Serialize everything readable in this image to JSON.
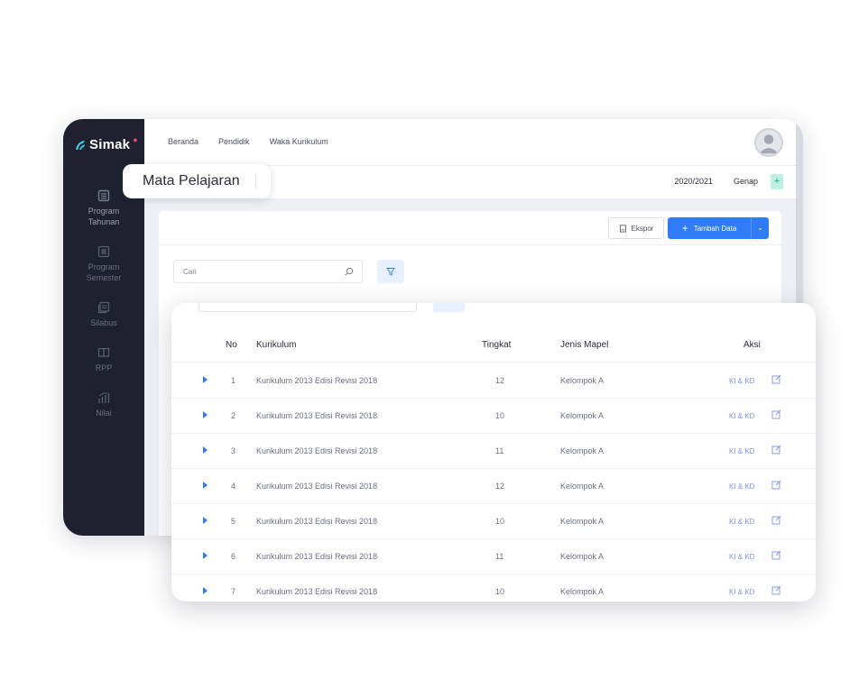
{
  "brand": {
    "name": "Simak"
  },
  "sidebar": {
    "items": [
      {
        "label": "Program Tahunan",
        "icon": "calendar-list-icon"
      },
      {
        "label": "Program Semester",
        "icon": "columns-icon"
      },
      {
        "label": "Silabus",
        "icon": "document-stack-icon"
      },
      {
        "label": "RPP",
        "icon": "book-open-icon"
      },
      {
        "label": "Nilai",
        "icon": "chart-up-icon"
      }
    ]
  },
  "topnav": {
    "items": [
      "Beranda",
      "Pendidik",
      "Waka Kurikulum"
    ]
  },
  "page": {
    "title": "Mata Pelajaran",
    "year": "2020/2021",
    "semester": "Genap"
  },
  "toolbar": {
    "export_label": "Ekspor",
    "add_label": "Tambah Data"
  },
  "search": {
    "placeholder": "Cari"
  },
  "table": {
    "headers": {
      "no": "No",
      "kurikulum": "Kurikulum",
      "tingkat": "Tingkat",
      "jenis": "Jenis Mapel",
      "aksi": "Aksi"
    },
    "action_link": "KI & KD",
    "rows": [
      {
        "no": "1",
        "kurikulum": "Kurikulum 2013 Edisi Revisi 2018",
        "tingkat": "12",
        "jenis": "Kelompok A"
      },
      {
        "no": "2",
        "kurikulum": "Kurikulum 2013 Edisi Revisi 2018",
        "tingkat": "10",
        "jenis": "Kelompok A"
      },
      {
        "no": "3",
        "kurikulum": "Kurikulum 2013 Edisi Revisi 2018",
        "tingkat": "11",
        "jenis": "Kelompok A"
      },
      {
        "no": "4",
        "kurikulum": "Kurikulum 2013 Edisi Revisi 2018",
        "tingkat": "12",
        "jenis": "Kelompok A"
      },
      {
        "no": "5",
        "kurikulum": "Kurikulum 2013 Edisi Revisi 2018",
        "tingkat": "10",
        "jenis": "Kelompok A"
      },
      {
        "no": "6",
        "kurikulum": "Kurikulum 2013 Edisi Revisi 2018",
        "tingkat": "11",
        "jenis": "Kelompok A"
      },
      {
        "no": "7",
        "kurikulum": "Kurikulum 2013 Edisi Revisi 2018",
        "tingkat": "10",
        "jenis": "Kelompok A"
      }
    ]
  },
  "colors": {
    "accent": "#2f7cf6",
    "sidebar": "#1f2130",
    "link": "#7e93e9",
    "brand_mark": "#3ec6e0"
  }
}
